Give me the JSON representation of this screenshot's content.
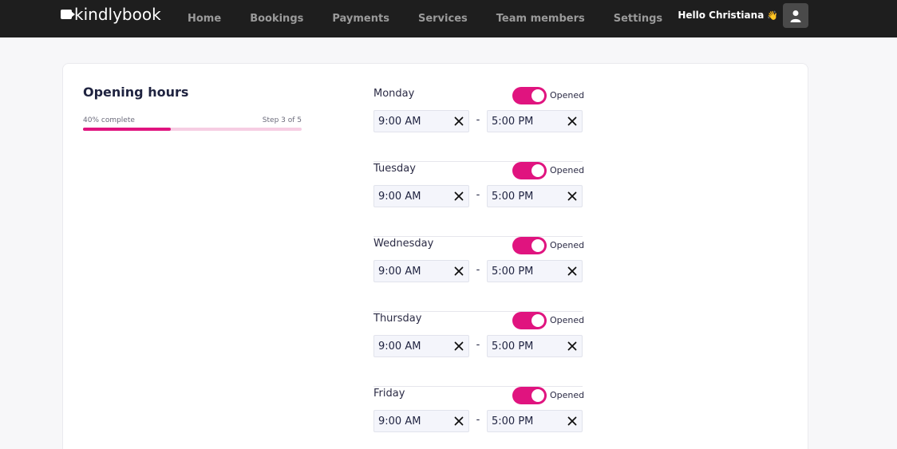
{
  "header": {
    "brand": "kindlybook",
    "nav": [
      "Home",
      "Bookings",
      "Payments",
      "Services",
      "Team members",
      "Settings"
    ],
    "greeting": "Hello Christiana",
    "greeting_icon": "waving-hand-icon",
    "avatar_icon": "user-icon"
  },
  "page": {
    "title": "Opening hours",
    "progress_label": "40% complete",
    "progress_value": 0.4,
    "step_label": "Step 3 of 5"
  },
  "colors": {
    "accent": "#e0147f",
    "topbar": "#1e1e1e"
  },
  "days": [
    {
      "name": "Monday",
      "status": "Opened",
      "from": "9:00 AM",
      "to": "5:00 PM",
      "separator": "-"
    },
    {
      "name": "Tuesday",
      "status": "Opened",
      "from": "9:00 AM",
      "to": "5:00 PM",
      "separator": "-"
    },
    {
      "name": "Wednesday",
      "status": "Opened",
      "from": "9:00 AM",
      "to": "5:00 PM",
      "separator": "-"
    },
    {
      "name": "Thursday",
      "status": "Opened",
      "from": "9:00 AM",
      "to": "5:00 PM",
      "separator": "-"
    },
    {
      "name": "Friday",
      "status": "Opened",
      "from": "9:00 AM",
      "to": "5:00 PM",
      "separator": "-"
    }
  ]
}
